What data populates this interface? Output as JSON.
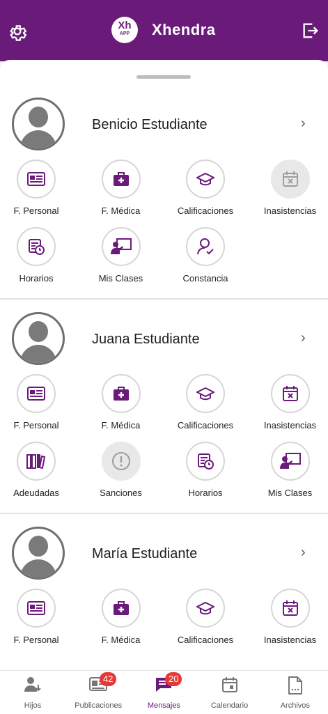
{
  "app": {
    "title": "Xhendra",
    "logo_text": "Xh",
    "logo_sub": "APP"
  },
  "colors": {
    "brand": "#6a1b7a",
    "badge": "#e53935",
    "disabled": "#9e9e9e"
  },
  "students": [
    {
      "name": "Benicio Estudiante",
      "actions": [
        {
          "label": "F. Personal",
          "icon": "id-card-icon"
        },
        {
          "label": "F. Médica",
          "icon": "medical-bag-icon"
        },
        {
          "label": "Calificaciones",
          "icon": "graduation-cap-icon"
        },
        {
          "label": "Inasistencias",
          "icon": "calendar-x-icon",
          "disabled": true
        },
        {
          "label": "Horarios",
          "icon": "schedule-icon"
        },
        {
          "label": "Mis Clases",
          "icon": "classroom-icon"
        },
        {
          "label": "Constancia",
          "icon": "user-check-icon"
        }
      ]
    },
    {
      "name": "Juana Estudiante",
      "actions": [
        {
          "label": "F. Personal",
          "icon": "id-card-icon"
        },
        {
          "label": "F. Médica",
          "icon": "medical-bag-icon"
        },
        {
          "label": "Calificaciones",
          "icon": "graduation-cap-icon"
        },
        {
          "label": "Inasistencias",
          "icon": "calendar-x-icon"
        },
        {
          "label": "Adeudadas",
          "icon": "books-icon"
        },
        {
          "label": "Sanciones",
          "icon": "alert-circle-icon",
          "disabled": true
        },
        {
          "label": "Horarios",
          "icon": "schedule-icon"
        },
        {
          "label": "Mis Clases",
          "icon": "classroom-icon"
        }
      ]
    },
    {
      "name": "María Estudiante",
      "actions": [
        {
          "label": "F. Personal",
          "icon": "id-card-icon"
        },
        {
          "label": "F. Médica",
          "icon": "medical-bag-icon"
        },
        {
          "label": "Calificaciones",
          "icon": "graduation-cap-icon"
        },
        {
          "label": "Inasistencias",
          "icon": "calendar-x-icon"
        }
      ]
    }
  ],
  "nav": [
    {
      "label": "Hijos",
      "icon": "children-icon"
    },
    {
      "label": "Publicaciones",
      "icon": "news-icon",
      "badge": "42"
    },
    {
      "label": "Mensajes",
      "icon": "messages-icon",
      "badge": "20",
      "active": true
    },
    {
      "label": "Calendario",
      "icon": "calendar-icon"
    },
    {
      "label": "Archivos",
      "icon": "file-icon"
    }
  ]
}
